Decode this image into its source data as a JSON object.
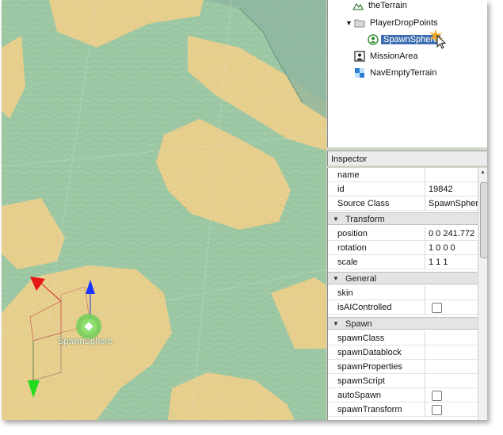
{
  "viewport": {
    "object_label": "SpawnSphere",
    "colors": {
      "terrain_green": "#9cc9a6",
      "terrain_sand": "#e7cf8e",
      "hill": "#8fb6a0"
    }
  },
  "tree": {
    "items": [
      {
        "label": "theTerrain",
        "icon": "terrain-icon"
      },
      {
        "label": "PlayerDropPoints",
        "icon": "folder-icon",
        "expanded": true
      },
      {
        "label": "SpawnSphere",
        "icon": "spawn-sphere-icon",
        "selected": true
      },
      {
        "label": "MissionArea",
        "icon": "mission-area-icon"
      },
      {
        "label": "NavEmptyTerrain",
        "icon": "nav-terrain-icon"
      }
    ]
  },
  "inspector": {
    "title": "Inspector",
    "top_fields": [
      {
        "name": "name",
        "value": ""
      },
      {
        "name": "id",
        "value": "19842"
      },
      {
        "name": "Source Class",
        "value": "SpawnSphere"
      }
    ],
    "sections": {
      "transform": {
        "title": "Transform",
        "fields": [
          {
            "name": "position",
            "value": "0 0 241.772"
          },
          {
            "name": "rotation",
            "value": "1 0 0 0"
          },
          {
            "name": "scale",
            "value": "1 1 1"
          }
        ]
      },
      "general": {
        "title": "General",
        "fields": [
          {
            "name": "skin",
            "value": ""
          },
          {
            "name": "isAIControlled",
            "checkbox": false
          }
        ]
      },
      "spawn": {
        "title": "Spawn",
        "fields": [
          {
            "name": "spawnClass",
            "value": ""
          },
          {
            "name": "spawnDatablock",
            "value": ""
          },
          {
            "name": "spawnProperties",
            "value": ""
          },
          {
            "name": "spawnScript",
            "value": ""
          },
          {
            "name": "autoSpawn",
            "checkbox": false
          },
          {
            "name": "spawnTransform",
            "checkbox": false
          }
        ]
      }
    }
  }
}
